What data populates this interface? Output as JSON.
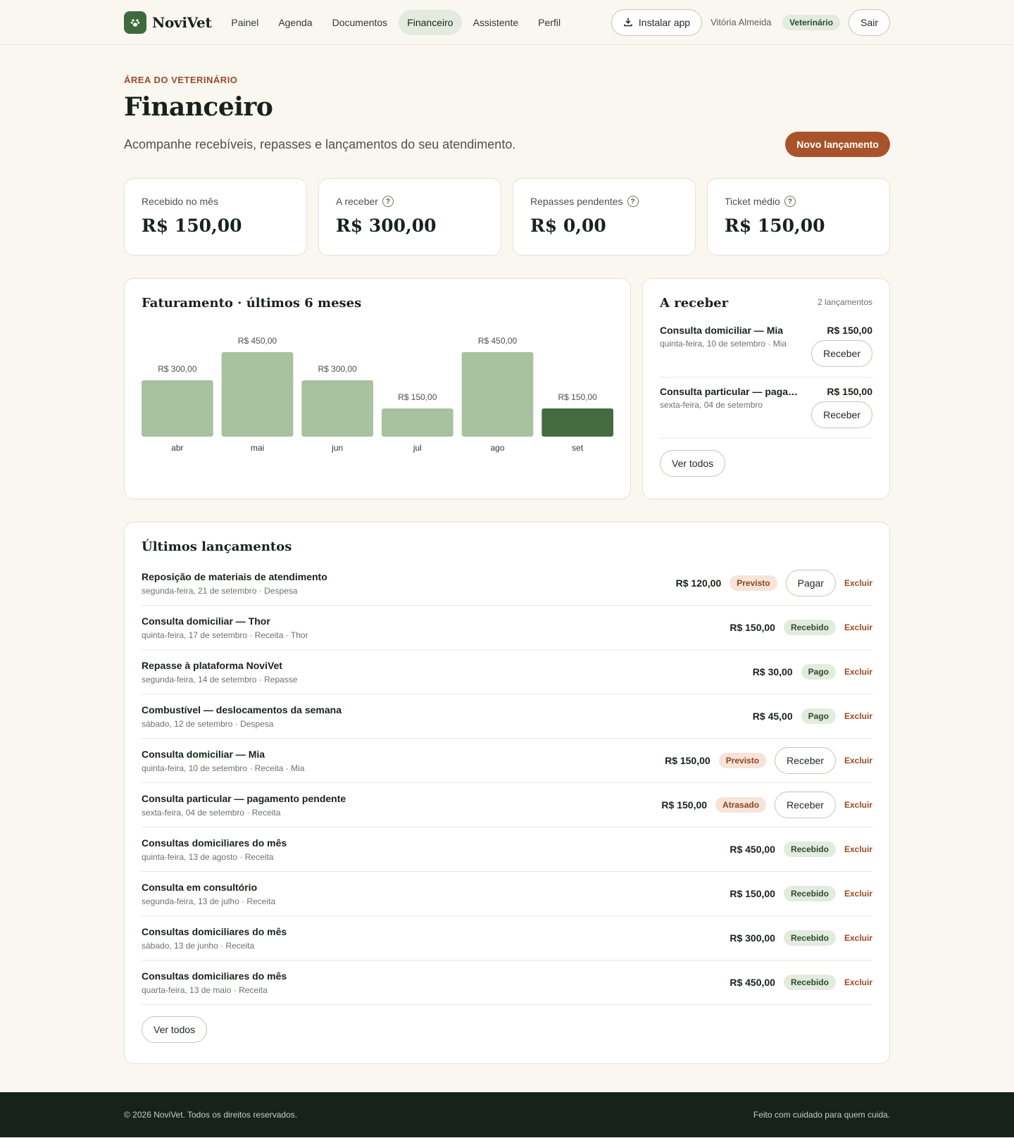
{
  "header": {
    "brand": "NoviVet",
    "nav": [
      {
        "label": "Painel",
        "active": false
      },
      {
        "label": "Agenda",
        "active": false
      },
      {
        "label": "Documentos",
        "active": false
      },
      {
        "label": "Financeiro",
        "active": true
      },
      {
        "label": "Assistente",
        "active": false
      },
      {
        "label": "Perfil",
        "active": false
      }
    ],
    "install_label": "Instalar app",
    "user_name": "Vitória Almeida",
    "role": "Veterinário",
    "logout_label": "Sair"
  },
  "page": {
    "eyebrow": "ÁREA DO VETERINÁRIO",
    "title": "Financeiro",
    "subtitle": "Acompanhe recebíveis, repasses e lançamentos do seu atendimento.",
    "new_entry_label": "Novo lançamento"
  },
  "stats": [
    {
      "label": "Recebido no mês",
      "value": "R$ 150,00",
      "help": false
    },
    {
      "label": "A receber",
      "value": "R$ 300,00",
      "help": true
    },
    {
      "label": "Repasses pendentes",
      "value": "R$ 0,00",
      "help": true
    },
    {
      "label": "Ticket médio",
      "value": "R$ 150,00",
      "help": true
    }
  ],
  "chart_data": {
    "type": "bar",
    "title": "Faturamento · últimos 6 meses",
    "categories": [
      "abr",
      "mai",
      "jun",
      "jul",
      "ago",
      "set"
    ],
    "values": [
      300,
      450,
      300,
      150,
      450,
      150
    ],
    "value_labels": [
      "R$ 300,00",
      "R$ 450,00",
      "R$ 300,00",
      "R$ 150,00",
      "R$ 450,00",
      "R$ 150,00"
    ],
    "highlight_index": 5,
    "colors": {
      "bar": "#a8c29f",
      "highlight": "#446b3f"
    },
    "ylim": [
      0,
      450
    ]
  },
  "receivables": {
    "title": "A receber",
    "count": "2 lançamentos",
    "items": [
      {
        "title": "Consulta domiciliar — Mia",
        "amount": "R$ 150,00",
        "sub": "quinta-feira, 10 de setembro · Mia",
        "action": "Receber"
      },
      {
        "title": "Consulta particular — pagamento pendente",
        "amount": "R$ 150,00",
        "sub": "sexta-feira, 04 de setembro",
        "action": "Receber"
      }
    ],
    "view_all": "Ver todos"
  },
  "entries": {
    "title": "Últimos lançamentos",
    "delete_label": "Excluir",
    "view_all": "Ver todos",
    "items": [
      {
        "title": "Reposição de materiais de atendimento",
        "sub": "segunda-feira, 21 de setembro · Despesa",
        "amount": "R$ 120,00",
        "status": "Previsto",
        "status_type": "previsto",
        "action": "Pagar"
      },
      {
        "title": "Consulta domiciliar — Thor",
        "sub": "quinta-feira, 17 de setembro · Receita · Thor",
        "amount": "R$ 150,00",
        "status": "Recebido",
        "status_type": "recebido",
        "action": ""
      },
      {
        "title": "Repasse à plataforma NoviVet",
        "sub": "segunda-feira, 14 de setembro · Repasse",
        "amount": "R$ 30,00",
        "status": "Pago",
        "status_type": "pago",
        "action": ""
      },
      {
        "title": "Combustível — deslocamentos da semana",
        "sub": "sábado, 12 de setembro · Despesa",
        "amount": "R$ 45,00",
        "status": "Pago",
        "status_type": "pago",
        "action": ""
      },
      {
        "title": "Consulta domiciliar — Mia",
        "sub": "quinta-feira, 10 de setembro · Receita · Mia",
        "amount": "R$ 150,00",
        "status": "Previsto",
        "status_type": "previsto",
        "action": "Receber"
      },
      {
        "title": "Consulta particular — pagamento pendente",
        "sub": "sexta-feira, 04 de setembro · Receita",
        "amount": "R$ 150,00",
        "status": "Atrasado",
        "status_type": "atrasado",
        "action": "Receber"
      },
      {
        "title": "Consultas domiciliares do mês",
        "sub": "quinta-feira, 13 de agosto · Receita",
        "amount": "R$ 450,00",
        "status": "Recebido",
        "status_type": "recebido",
        "action": ""
      },
      {
        "title": "Consulta em consultório",
        "sub": "segunda-feira, 13 de julho · Receita",
        "amount": "R$ 150,00",
        "status": "Recebido",
        "status_type": "recebido",
        "action": ""
      },
      {
        "title": "Consultas domiciliares do mês",
        "sub": "sábado, 13 de junho · Receita",
        "amount": "R$ 300,00",
        "status": "Recebido",
        "status_type": "recebido",
        "action": ""
      },
      {
        "title": "Consultas domiciliares do mês",
        "sub": "quarta-feira, 13 de maio · Receita",
        "amount": "R$ 450,00",
        "status": "Recebido",
        "status_type": "recebido",
        "action": ""
      }
    ]
  },
  "footer": {
    "copyright": "© 2026 NoviVet. Todos os direitos reservados.",
    "tagline": "Feito com cuidado para quem cuida."
  }
}
